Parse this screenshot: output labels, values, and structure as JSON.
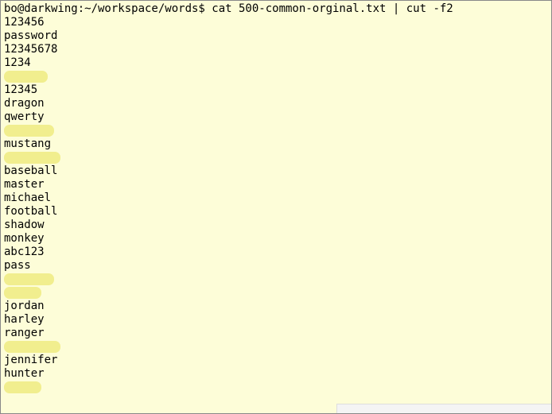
{
  "prompt": "bo@darkwing:~/workspace/words$ cat 500-common-orginal.txt | cut -f2",
  "lines": [
    {
      "text": "123456"
    },
    {
      "text": "password"
    },
    {
      "text": "12345678"
    },
    {
      "text": "1234"
    },
    {
      "redact_width": 55
    },
    {
      "text": "12345"
    },
    {
      "text": "dragon"
    },
    {
      "text": "qwerty"
    },
    {
      "redact_width": 63
    },
    {
      "text": "mustang"
    },
    {
      "redact_width": 71
    },
    {
      "text": "baseball"
    },
    {
      "text": "master"
    },
    {
      "text": "michael"
    },
    {
      "text": "football"
    },
    {
      "text": "shadow"
    },
    {
      "text": "monkey"
    },
    {
      "text": "abc123"
    },
    {
      "text": "pass"
    },
    {
      "redact_width": 63
    },
    {
      "redact_width": 47
    },
    {
      "text": "jordan"
    },
    {
      "text": "harley"
    },
    {
      "text": "ranger"
    },
    {
      "redact_width": 71
    },
    {
      "text": "jennifer"
    },
    {
      "text": "hunter"
    },
    {
      "redact_width": 47
    }
  ]
}
